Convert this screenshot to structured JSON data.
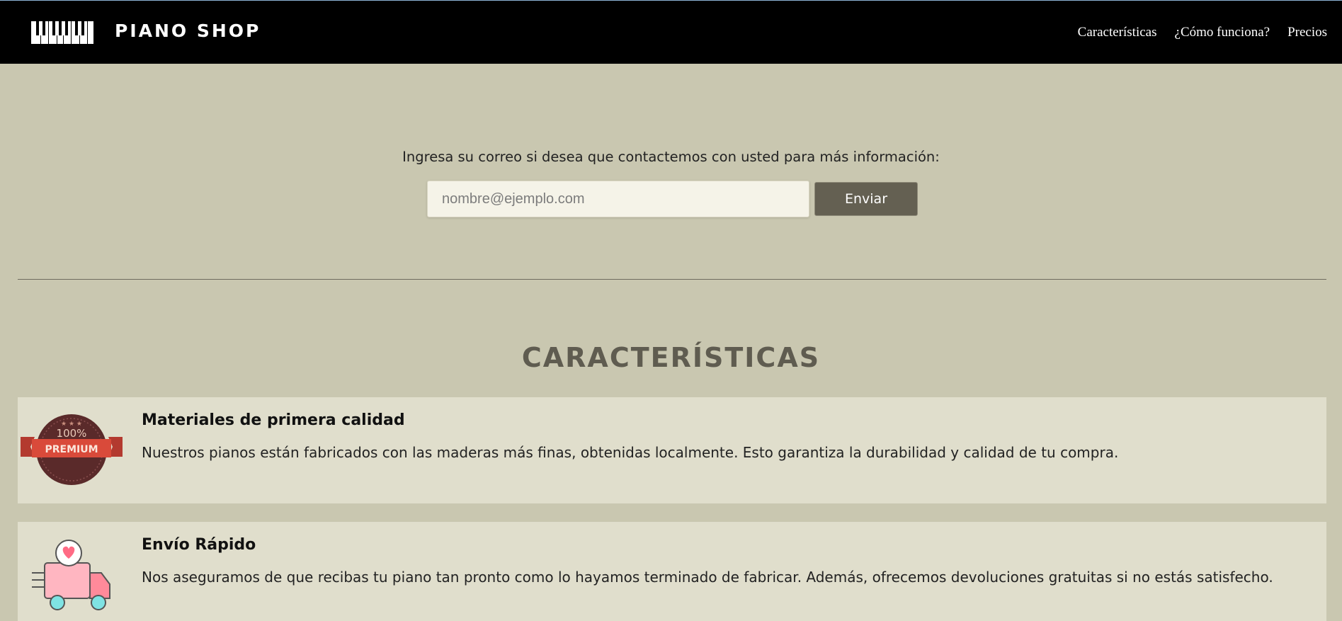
{
  "header": {
    "brand": "PIANO SHOP",
    "logo_icon": "piano-keys-logo",
    "nav": [
      {
        "label": "Características"
      },
      {
        "label": "¿Cómo funciona?"
      },
      {
        "label": "Precios"
      }
    ]
  },
  "signup": {
    "prompt": "Ingresa su correo si desea que contactemos con usted para más información:",
    "email_placeholder": "nombre@ejemplo.com",
    "email_value": "",
    "submit_label": "Enviar"
  },
  "features": {
    "title": "CARACTERÍSTICAS",
    "items": [
      {
        "icon": "premium-badge-icon",
        "badge_percent": "100%",
        "badge_label": "PREMIUM",
        "title": "Materiales de primera calidad",
        "description": "Nuestros pianos están fabricados con las maderas más finas, obtenidas localmente. Esto garantiza la durabilidad y calidad de tu compra."
      },
      {
        "icon": "delivery-truck-icon",
        "title": "Envío Rápido",
        "description": "Nos aseguramos de que recibas tu piano tan pronto como lo hayamos terminado de fabricar. Además, ofrecemos devoluciones gratuitas si no estás satisfecho."
      }
    ]
  },
  "colors": {
    "header_bg": "#000000",
    "page_bg": "#c9c7b0",
    "card_bg": "#e0decc",
    "button_bg": "#646052",
    "title_color": "#5f5c50"
  }
}
